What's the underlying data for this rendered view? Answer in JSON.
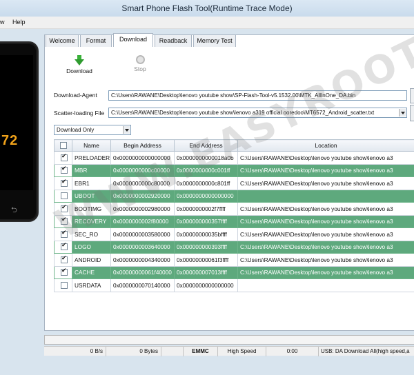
{
  "window": {
    "title": "Smart Phone Flash Tool(Runtime Trace Mode)"
  },
  "menu": {
    "items": [
      "w",
      "Help"
    ]
  },
  "phone": {
    "chip_text": "72",
    "back_glyph": "⮌"
  },
  "tabs": [
    "Welcome",
    "Format",
    "Download",
    "Readback",
    "Memory Test"
  ],
  "active_tab": "Download",
  "toolbar": {
    "download_label": "Download",
    "stop_label": "Stop"
  },
  "download_agent": {
    "label": "Download-Agent",
    "value": "C:\\Users\\RAWANE\\Desktop\\lenovo youtube show\\SP-Flash-Tool-v5.1532.00\\MTK_AllInOne_DA.bin"
  },
  "scatter": {
    "label": "Scatter-loading File",
    "value": "C:\\Users\\RAWANE\\Desktop\\lenovo youtube show\\lenovo a319 official ooredoo\\MT6572_Android_scatter.txt"
  },
  "mode_select": {
    "value": "Download Only"
  },
  "table": {
    "headers": [
      "",
      "Name",
      "Begin Address",
      "End Address",
      "Location"
    ],
    "rows": [
      {
        "checked": true,
        "selected": false,
        "name": "PRELOADER",
        "begin": "0x0000000000000000",
        "end": "0x0000000000018a0b",
        "location": "C:\\Users\\RAWANE\\Desktop\\lenovo youtube show\\lenovo a3"
      },
      {
        "checked": true,
        "selected": true,
        "name": "MBR",
        "begin": "0x0000000000c00000",
        "end": "0x0000000000c001ff",
        "location": "C:\\Users\\RAWANE\\Desktop\\lenovo youtube show\\lenovo a3"
      },
      {
        "checked": true,
        "selected": false,
        "name": "EBR1",
        "begin": "0x0000000000c80000",
        "end": "0x0000000000c801ff",
        "location": "C:\\Users\\RAWANE\\Desktop\\lenovo youtube show\\lenovo a3"
      },
      {
        "checked": false,
        "selected": true,
        "name": "UBOOT",
        "begin": "0x0000000002920000",
        "end": "0x0000000000000000",
        "location": ""
      },
      {
        "checked": true,
        "selected": false,
        "name": "BOOTIMG",
        "begin": "0x0000000002980000",
        "end": "0x0000000002f7ffff",
        "location": "C:\\Users\\RAWANE\\Desktop\\lenovo youtube show\\lenovo a3"
      },
      {
        "checked": true,
        "selected": true,
        "name": "RECOVERY",
        "begin": "0x0000000002f80000",
        "end": "0x000000000357ffff",
        "location": "C:\\Users\\RAWANE\\Desktop\\lenovo youtube show\\lenovo a3"
      },
      {
        "checked": true,
        "selected": false,
        "name": "SEC_RO",
        "begin": "0x0000000003580000",
        "end": "0x00000000035bffff",
        "location": "C:\\Users\\RAWANE\\Desktop\\lenovo youtube show\\lenovo a3"
      },
      {
        "checked": true,
        "selected": true,
        "name": "LOGO",
        "begin": "0x0000000003640000",
        "end": "0x000000000393ffff",
        "location": "C:\\Users\\RAWANE\\Desktop\\lenovo youtube show\\lenovo a3"
      },
      {
        "checked": true,
        "selected": false,
        "name": "ANDROID",
        "begin": "0x0000000004340000",
        "end": "0x00000000061f3ffff",
        "location": "C:\\Users\\RAWANE\\Desktop\\lenovo youtube show\\lenovo a3"
      },
      {
        "checked": true,
        "selected": true,
        "name": "CACHE",
        "begin": "0x00000000061f40000",
        "end": "0x000000007013ffff",
        "location": "C:\\Users\\RAWANE\\Desktop\\lenovo youtube show\\lenovo a3"
      },
      {
        "checked": false,
        "selected": false,
        "name": "USRDATA",
        "begin": "0x0000000070140000",
        "end": "0x0000000000000000",
        "location": ""
      }
    ]
  },
  "status": {
    "speed": "0 B/s",
    "bytes": "0 Bytes",
    "storage": "EMMC",
    "mode": "High Speed",
    "time": "0:00",
    "usb": "USB: DA Download All(high speed,a"
  },
  "colors": {
    "selected_row": "#5ea97d",
    "accent_download": "#2f9b2f",
    "chip_text": "#f0a21a"
  }
}
